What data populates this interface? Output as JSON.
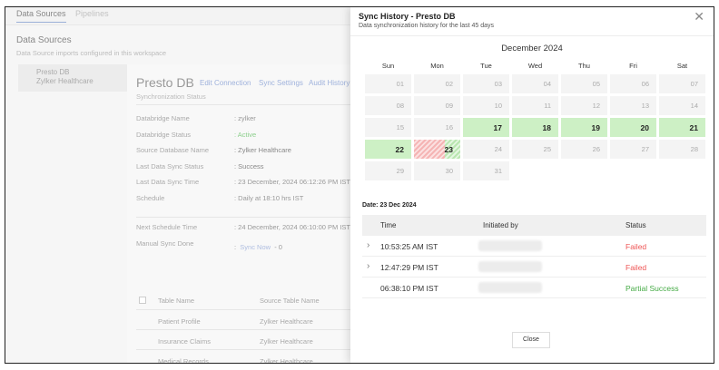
{
  "tabs": [
    "Data Sources",
    "Pipelines"
  ],
  "page": {
    "title": "Data Sources",
    "subtitle": "Data Source imports configured in this workspace",
    "source": {
      "name": "Presto DB",
      "org": "Zylker Healthcare"
    },
    "detail": {
      "title": "Presto DB",
      "links": [
        "Edit Connection",
        "Sync Settings",
        "Audit History"
      ],
      "subtitle": "Synchronization Status",
      "fields": [
        {
          "label": "Databridge Name",
          "value": ": zylker"
        },
        {
          "label": "Databridge Status",
          "value": ": Active"
        },
        {
          "label": "Source Database Name",
          "value": ": Zylker Healthcare"
        },
        {
          "label": "Last Data Sync Status",
          "value": ": Success"
        },
        {
          "label": "Last Data Sync Time",
          "value": ": 23 December, 2024 06:12:26 PM IST"
        },
        {
          "label": "Schedule",
          "value": ": Daily at 18:10 hrs IST"
        }
      ],
      "next": {
        "label": "Next Schedule Time",
        "value": ": 24 December, 2024 06:10:00 PM IST"
      },
      "manual": {
        "label": "Manual Sync Done",
        "sep": ":",
        "link": "Sync Now",
        "count": "- 0"
      },
      "table": {
        "headers": [
          "Table Name",
          "Source Table Name"
        ],
        "rows": [
          [
            "Patient Profile",
            "Zylker Healthcare"
          ],
          [
            "Insurance Claims",
            "Zylker Healthcare"
          ],
          [
            "Medical Records",
            "Zylker Healthcare"
          ]
        ]
      }
    }
  },
  "panel": {
    "title": "Sync History - Presto DB",
    "subtitle": "Data synchronization history for the last 45 days",
    "month": "December 2024",
    "days": [
      "Sun",
      "Mon",
      "Tue",
      "Wed",
      "Thu",
      "Fri",
      "Sat"
    ],
    "dates": [
      "01",
      "02",
      "03",
      "04",
      "05",
      "06",
      "07",
      "08",
      "09",
      "10",
      "11",
      "12",
      "13",
      "14",
      "15",
      "16",
      "17",
      "18",
      "19",
      "20",
      "21",
      "22",
      "23",
      "24",
      "25",
      "26",
      "27",
      "28",
      "29",
      "30",
      "31"
    ],
    "success_dates": [
      "17",
      "18",
      "19",
      "20",
      "21",
      "22"
    ],
    "mixed_dates": [
      "23"
    ],
    "selected_date": "Date: 23 Dec 2024",
    "history_headers": [
      "Time",
      "Initiated by",
      "Status"
    ],
    "history": [
      {
        "time": "10:53:25 AM IST",
        "status": "Failed",
        "expandable": true
      },
      {
        "time": "12:47:29 PM IST",
        "status": "Failed",
        "expandable": true
      },
      {
        "time": "06:38:10 PM IST",
        "status": "Partial Success",
        "expandable": false
      }
    ],
    "close_label": "Close"
  },
  "colors": {
    "success": "#cdf0c5",
    "failed": "#e55555",
    "partial": "#44aa44"
  }
}
